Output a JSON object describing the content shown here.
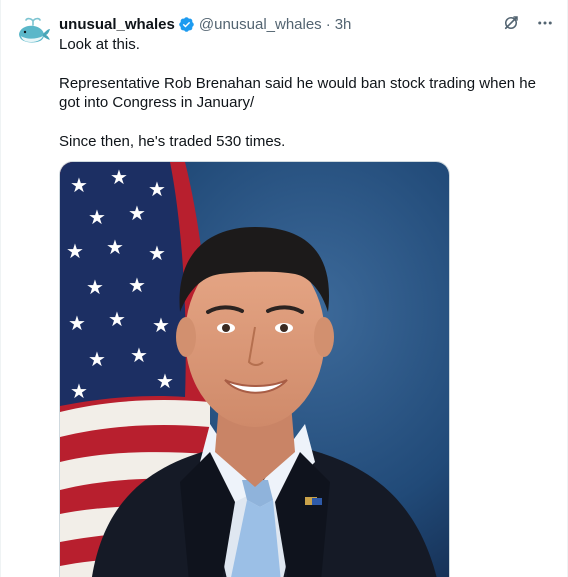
{
  "tweet": {
    "display_name": "unusual_whales",
    "handle": "@unusual_whales",
    "separator": "·",
    "time": "3h",
    "text": {
      "line1": "Look at this.",
      "line2": "Representative Rob Brenahan said he would ban stock trading when he got into Congress in January/",
      "line3": "Since then, he's traded 530 times."
    }
  },
  "icons": {
    "verified": "verified-badge-icon",
    "grok": "grok-icon",
    "more": "more-options-icon",
    "avatar": "whale-logo"
  },
  "colors": {
    "verified": "#1d9bf0",
    "text_primary": "#0f1419",
    "text_secondary": "#536471",
    "whale": "#5bb7c9"
  }
}
